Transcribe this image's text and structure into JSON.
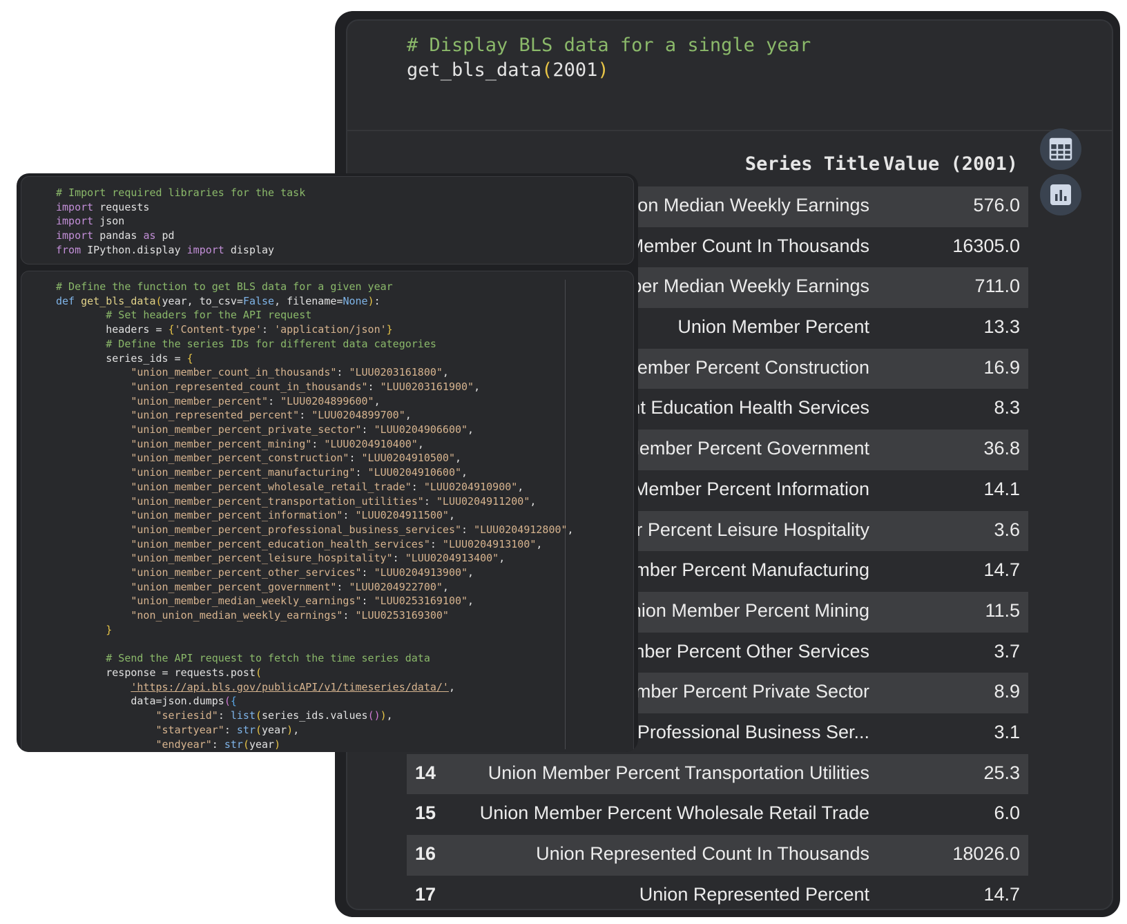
{
  "notebook_output": {
    "comment": "# Display BLS data for a single year",
    "call_name": "get_bls_data",
    "call_paren_open": "(",
    "call_arg": "2001",
    "call_paren_close": ")",
    "table": {
      "col_title": "Series Title",
      "col_value": "Value (2001)",
      "rows": [
        {
          "index": "",
          "title": "ion Median Weekly Earnings",
          "value": "576.0"
        },
        {
          "index": "",
          "title": "Member Count In Thousands",
          "value": "16305.0"
        },
        {
          "index": "",
          "title": "ber Median Weekly Earnings",
          "value": "711.0"
        },
        {
          "index": "",
          "title": "Union Member Percent",
          "value": "13.3"
        },
        {
          "index": "",
          "title": "lember Percent Construction",
          "value": "16.9"
        },
        {
          "index": "",
          "title": "nt Education Health Services",
          "value": "8.3"
        },
        {
          "index": "",
          "title": "lember Percent Government",
          "value": "36.8"
        },
        {
          "index": "",
          "title": "Member Percent Information",
          "value": "14.1"
        },
        {
          "index": "",
          "title": "r Percent Leisure Hospitality",
          "value": "3.6"
        },
        {
          "index": "",
          "title": "mber Percent Manufacturing",
          "value": "14.7"
        },
        {
          "index": "",
          "title": "nion Member Percent Mining",
          "value": "11.5"
        },
        {
          "index": "",
          "title": "nber Percent Other Services",
          "value": "3.7"
        },
        {
          "index": "",
          "title": "mber Percent Private Sector",
          "value": "8.9"
        },
        {
          "index": "",
          "title": "Professional Business Ser...",
          "value": "3.1"
        },
        {
          "index": "14",
          "title": "Union Member Percent Transportation Utilities",
          "value": "25.3"
        },
        {
          "index": "15",
          "title": "Union Member Percent Wholesale Retail Trade",
          "value": "6.0"
        },
        {
          "index": "16",
          "title": "Union Represented Count In Thousands",
          "value": "18026.0"
        },
        {
          "index": "17",
          "title": "Union Represented Percent",
          "value": "14.7"
        }
      ]
    },
    "buttons": {
      "table_icon": "table-icon",
      "chart_icon": "bar-chart-icon"
    }
  },
  "code_cell_1": {
    "comment": "# Import required libraries for the task",
    "kw_import": "import",
    "kw_as": "as",
    "kw_from": "from",
    "mod_requests": " requests",
    "mod_json": " json",
    "mod_pandas": " pandas ",
    "alias_pd": " pd",
    "mod_ipython": " IPython.display ",
    "name_display": " display"
  },
  "code_cell_2": {
    "c_define": "# Define the function to get BLS data for a given year",
    "kw_def": "def",
    "fn_name": " get_bls_data",
    "p_open": "(",
    "param_year": "year, ",
    "param_csv": "to_csv",
    "eq": "=",
    "val_false": "False",
    "comma_sp": ", ",
    "param_filename": "filename",
    "val_none": "None",
    "p_close": ")",
    "colon": ":",
    "c_headers": "# Set headers for the API request",
    "headers_lhs": "headers = ",
    "brace_open": "{",
    "brace_close": "}",
    "hdr_key": "'Content-type'",
    "hdr_sep": ": ",
    "hdr_val": "'application/json'",
    "c_series": "# Define the series IDs for different data categories",
    "series_lhs": "series_ids = ",
    "series": [
      {
        "key": "\"union_member_count_in_thousands\"",
        "val": "\"LUU0203161800\"",
        "end": ","
      },
      {
        "key": "\"union_represented_count_in_thousands\"",
        "val": "\"LUU0203161900\"",
        "end": ","
      },
      {
        "key": "\"union_member_percent\"",
        "val": "\"LUU0204899600\"",
        "end": ","
      },
      {
        "key": "\"union_represented_percent\"",
        "val": "\"LUU0204899700\"",
        "end": ","
      },
      {
        "key": "\"union_member_percent_private_sector\"",
        "val": "\"LUU0204906600\"",
        "end": ","
      },
      {
        "key": "\"union_member_percent_mining\"",
        "val": "\"LUU0204910400\"",
        "end": ","
      },
      {
        "key": "\"union_member_percent_construction\"",
        "val": "\"LUU0204910500\"",
        "end": ","
      },
      {
        "key": "\"union_member_percent_manufacturing\"",
        "val": "\"LUU0204910600\"",
        "end": ","
      },
      {
        "key": "\"union_member_percent_wholesale_retail_trade\"",
        "val": "\"LUU0204910900\"",
        "end": ","
      },
      {
        "key": "\"union_member_percent_transportation_utilities\"",
        "val": "\"LUU0204911200\"",
        "end": ","
      },
      {
        "key": "\"union_member_percent_information\"",
        "val": "\"LUU0204911500\"",
        "end": ","
      },
      {
        "key": "\"union_member_percent_professional_business_services\"",
        "val": "\"LUU0204912800\"",
        "end": ","
      },
      {
        "key": "\"union_member_percent_education_health_services\"",
        "val": "\"LUU0204913100\"",
        "end": ","
      },
      {
        "key": "\"union_member_percent_leisure_hospitality\"",
        "val": "\"LUU0204913400\"",
        "end": ","
      },
      {
        "key": "\"union_member_percent_other_services\"",
        "val": "\"LUU0204913900\"",
        "end": ","
      },
      {
        "key": "\"union_member_percent_government\"",
        "val": "\"LUU0204922700\"",
        "end": ","
      },
      {
        "key": "\"union_member_median_weekly_earnings\"",
        "val": "\"LUU0253169100\"",
        "end": ","
      },
      {
        "key": "\"non_union_median_weekly_earnings\"",
        "val": "\"LUU0253169300\"",
        "end": ""
      }
    ],
    "c_send": "# Send the API request to fetch the time series data",
    "resp_lhs": "response = requests.post",
    "url": "'https://api.bls.gov/publicAPI/v1/timeseries/data/'",
    "comma": ",",
    "data_lhs": "data=json.dumps",
    "k_seriesid": "\"seriesid\"",
    "fn_list": "list",
    "arg_series_values": "series_ids.values",
    "empty_parens": "()",
    "k_startyear": "\"startyear\"",
    "fn_str": "str",
    "arg_year": "year",
    "k_endyear": "\"endyear\""
  }
}
